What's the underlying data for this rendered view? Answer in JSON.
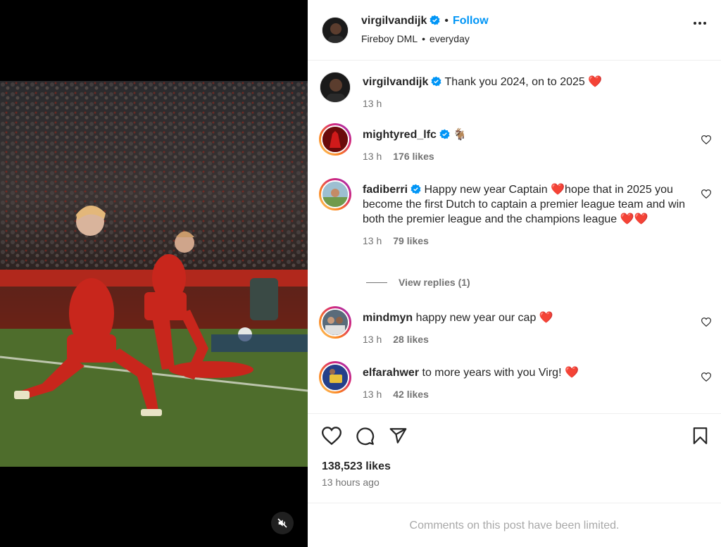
{
  "header": {
    "username": "virgilvandijk",
    "follow_label": "Follow",
    "audio_artist": "Fireboy DML",
    "audio_track": "everyday",
    "more_icon": "more-horizontal-icon"
  },
  "caption": {
    "username": "virgilvandijk",
    "text": "Thank you 2024, on to 2025 ❤️",
    "time": "13 h"
  },
  "comments": [
    {
      "username": "mightyred_lfc",
      "verified": true,
      "text": "🐐",
      "time": "13 h",
      "likes": "176 likes"
    },
    {
      "username": "fadiberri",
      "verified": true,
      "text": "Happy new year Captain ❤️hope that in 2025 you become the first Dutch to captain a premier league team and win both the premier league and the champions league ❤️❤️",
      "time": "13 h",
      "likes": "79 likes"
    },
    {
      "username": "mindmyn",
      "verified": false,
      "text": "happy new year our cap ❤️",
      "time": "13 h",
      "likes": "28 likes"
    },
    {
      "username": "elfarahwer",
      "verified": false,
      "text": "to more years with you Virg! ❤️",
      "time": "13 h",
      "likes": "42 likes"
    }
  ],
  "view_replies": "View replies (1)",
  "actions": {
    "like_icon": "heart-icon",
    "comment_icon": "comment-icon",
    "share_icon": "send-icon",
    "save_icon": "bookmark-icon"
  },
  "likes_total": "138,523 likes",
  "posted_ago": "13 hours ago",
  "comments_limited": "Comments on this post have been limited.",
  "colors": {
    "accent": "#0095f6",
    "verified": "#0095f6",
    "heart": "#ed4956",
    "muted": "#737373"
  }
}
